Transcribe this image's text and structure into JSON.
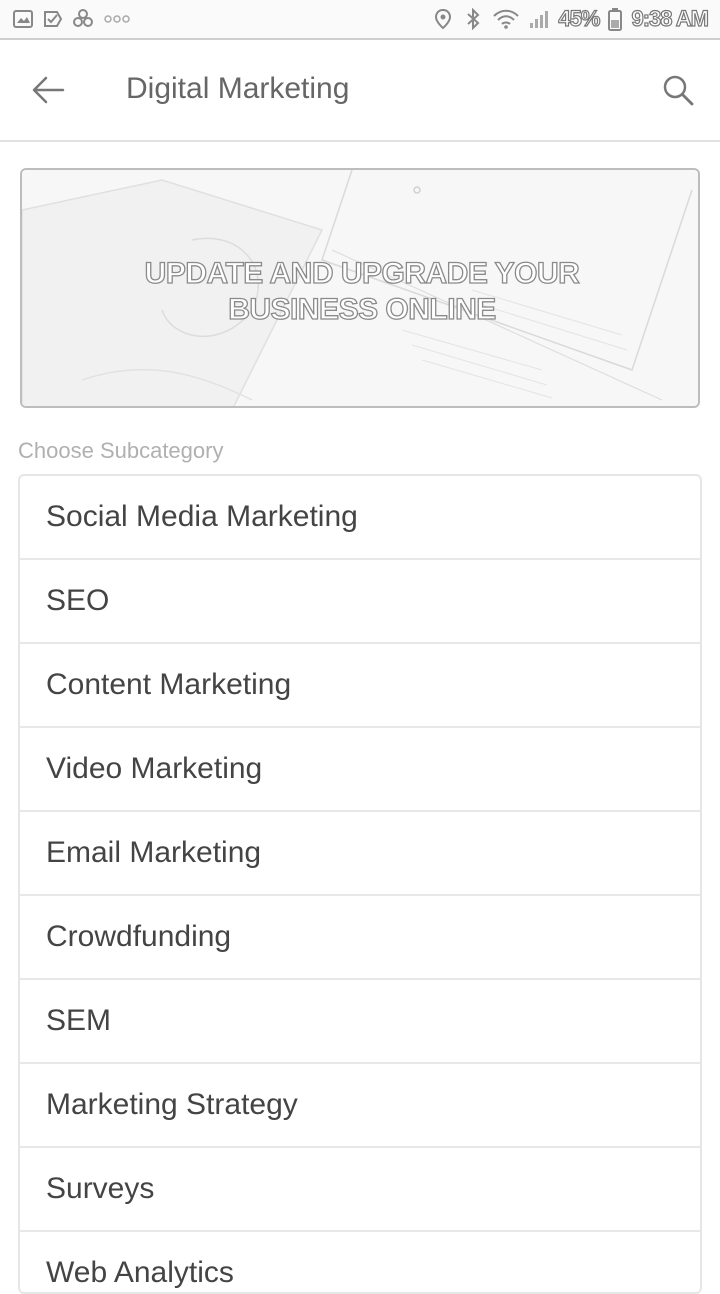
{
  "status_bar": {
    "battery_percent": "45%",
    "time": "9:38 AM",
    "left_icons": [
      "image-notification-icon",
      "check-notification-icon",
      "pinwheel-notification-icon",
      "more-notifications-icon"
    ],
    "right_icons": [
      "location-icon",
      "bluetooth-icon",
      "wifi-icon",
      "signal-icon",
      "battery-icon"
    ]
  },
  "app_bar": {
    "title": "Digital Marketing",
    "back_icon": "arrow-left-icon",
    "search_icon": "search-icon"
  },
  "banner": {
    "headline_line1": "UPDATE AND UPGRADE YOUR",
    "headline_line2": "BUSINESS ONLINE"
  },
  "subcategories": {
    "header": "Choose Subcategory",
    "items": [
      {
        "label": "Social Media Marketing"
      },
      {
        "label": "SEO"
      },
      {
        "label": "Content Marketing"
      },
      {
        "label": "Video Marketing"
      },
      {
        "label": "Email Marketing"
      },
      {
        "label": "Crowdfunding"
      },
      {
        "label": "SEM"
      },
      {
        "label": "Marketing Strategy"
      },
      {
        "label": "Surveys"
      },
      {
        "label": "Web Analytics"
      }
    ]
  },
  "colors": {
    "title_text": "#666666",
    "header_text": "#b0b0b0",
    "item_text": "#444444",
    "divider": "#e8e8e8"
  }
}
